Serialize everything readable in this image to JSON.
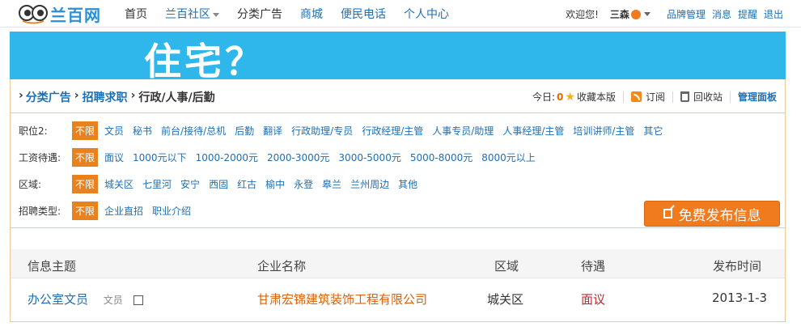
{
  "logo": {
    "text": "兰百网"
  },
  "nav": [
    {
      "label": "首页"
    },
    {
      "label": "兰百社区"
    },
    {
      "label": "分类广告"
    },
    {
      "label": "商城"
    },
    {
      "label": "便民电话"
    },
    {
      "label": "个人中心"
    }
  ],
  "user": {
    "welcome": "欢迎您!",
    "name": "三森",
    "links": [
      "品牌管理",
      "消息",
      "提醒",
      "退出"
    ]
  },
  "banner": {
    "text": "住宅？"
  },
  "breadcrumb": {
    "items": [
      "分类广告",
      "招聘求职",
      "行政/人事/后勤"
    ]
  },
  "tools": {
    "today_label": "今日:",
    "today_count": "0",
    "favorite": "收藏本版",
    "subscribe": "订阅",
    "recycle": "回收站",
    "admin": "管理面板"
  },
  "filters": [
    {
      "label": "职位2:",
      "options": [
        "不限",
        "文员",
        "秘书",
        "前台/接待/总机",
        "后勤",
        "翻译",
        "行政助理/专员",
        "行政经理/主管",
        "人事专员/助理",
        "人事经理/主管",
        "培训讲师/主管",
        "其它"
      ]
    },
    {
      "label": "工资待遇:",
      "options": [
        "不限",
        "面议",
        "1000元以下",
        "1000-2000元",
        "2000-3000元",
        "3000-5000元",
        "5000-8000元",
        "8000元以上"
      ]
    },
    {
      "label": "区域:",
      "options": [
        "不限",
        "城关区",
        "七里河",
        "安宁",
        "西固",
        "红古",
        "榆中",
        "永登",
        "皋兰",
        "兰州周边",
        "其他"
      ]
    },
    {
      "label": "招聘类型:",
      "options": [
        "不限",
        "企业直招",
        "职业介绍"
      ]
    }
  ],
  "publish_button": "免费发布信息",
  "table": {
    "headers": [
      "信息主题",
      "企业名称",
      "区域",
      "待遇",
      "发布时间"
    ],
    "rows": [
      {
        "title": "办公室文员",
        "category": "文员",
        "company": "甘肃宏锦建筑装饰工程有限公司",
        "area": "城关区",
        "salary": "面议",
        "date": "2013-1-3"
      }
    ]
  },
  "colors": {
    "accent": "#e8821e",
    "banner": "#2fb6ea",
    "link": "#1f6fb3"
  }
}
